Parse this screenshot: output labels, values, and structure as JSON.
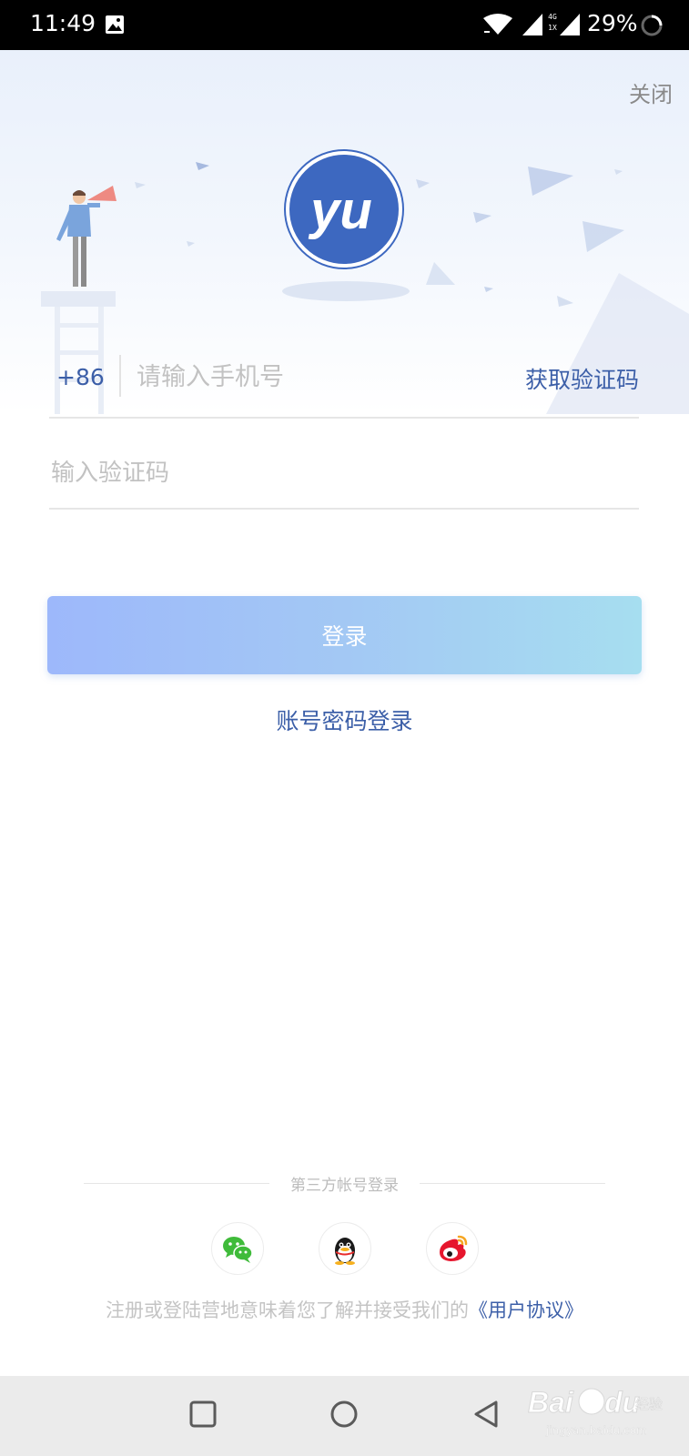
{
  "status_bar": {
    "time": "11:49",
    "network_type_top": "4G",
    "network_type_bottom": "1X",
    "battery": "29%"
  },
  "header": {
    "close_label": "关闭",
    "logo_text": "yu"
  },
  "login_form": {
    "country_code": "+86",
    "phone_placeholder": "请输入手机号",
    "get_code_label": "获取验证码",
    "code_placeholder": "输入验证码",
    "login_button_label": "登录",
    "password_login_label": "账号密码登录"
  },
  "third_party": {
    "title": "第三方帐号登录",
    "providers": [
      "wechat",
      "qq",
      "weibo"
    ]
  },
  "agreement": {
    "text": "注册或登陆营地意味着您了解并接受我们的",
    "link_label": "《用户协议》"
  },
  "watermark": {
    "text": "Baidu经验",
    "sub": "jingyan.baidu.com"
  },
  "colors": {
    "accent": "#3c5fa8",
    "logo_blue": "#3d68c0",
    "button_gradient_start": "#9db8fb",
    "button_gradient_end": "#a6def0",
    "placeholder": "#c2c2c2"
  },
  "icons": [
    "image-icon",
    "wifi-icon",
    "signal-icon",
    "loading-icon",
    "wechat-icon",
    "qq-icon",
    "weibo-icon",
    "recent-apps-icon",
    "home-icon",
    "back-icon"
  ]
}
